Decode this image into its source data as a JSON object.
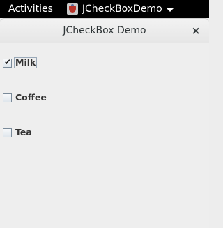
{
  "topbar": {
    "activities_label": "Activities",
    "app_label": "JCheckBoxDemo"
  },
  "window": {
    "title": "JCheckBox Demo",
    "close_glyph": "×"
  },
  "checkboxes": [
    {
      "label": "Milk",
      "checked": true,
      "focused": true
    },
    {
      "label": "Coffee",
      "checked": false,
      "focused": false
    },
    {
      "label": "Tea",
      "checked": false,
      "focused": false
    }
  ]
}
